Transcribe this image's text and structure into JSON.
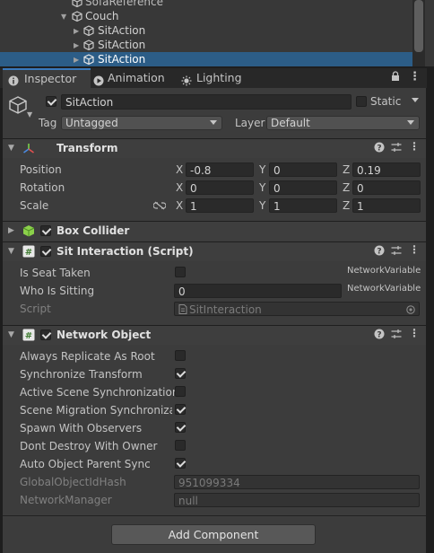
{
  "hierarchy": {
    "rows": [
      {
        "label": "SofaReference",
        "y": -6,
        "indent": 80,
        "arrow": false
      },
      {
        "label": "Couch",
        "y": 10,
        "indent": 66,
        "arrow": true
      },
      {
        "label": "SitAction",
        "y": 26,
        "indent": 80,
        "arrow": true
      },
      {
        "label": "SitAction",
        "y": 42,
        "indent": 80,
        "arrow": true
      },
      {
        "label": "SitAction",
        "y": 58,
        "indent": 80,
        "arrow": true,
        "selected": true
      }
    ]
  },
  "tabs": {
    "inspector": "Inspector",
    "animation": "Animation",
    "lighting": "Lighting"
  },
  "object": {
    "name": "SitAction",
    "static_label": "Static",
    "tag_label": "Tag",
    "tag_value": "Untagged",
    "layer_label": "Layer",
    "layer_value": "Default"
  },
  "transform": {
    "title": "Transform",
    "position_label": "Position",
    "rotation_label": "Rotation",
    "scale_label": "Scale",
    "position": {
      "x": "-0.8",
      "y": "0",
      "z": "0.19"
    },
    "rotation": {
      "x": "0",
      "y": "0",
      "z": "0"
    },
    "scale": {
      "x": "1",
      "y": "1",
      "z": "1"
    },
    "axis_x": "X",
    "axis_y": "Y",
    "axis_z": "Z"
  },
  "box_collider": {
    "title": "Box Collider"
  },
  "sit_interaction": {
    "title": "Sit Interaction (Script)",
    "is_seat_taken_label": "Is Seat Taken",
    "who_is_sitting_label": "Who Is Sitting",
    "who_is_sitting_value": "0",
    "network_variable_1": "NetworkVariable",
    "network_variable_2": "NetworkVariable",
    "script_label": "Script",
    "script_value": "SitInteraction"
  },
  "network_object": {
    "title": "Network Object",
    "always_replicate_label": "Always Replicate As Root",
    "sync_transform_label": "Synchronize Transform",
    "active_scene_label": "Active Scene Synchronization",
    "scene_migration_label": "Scene Migration Synchronizat",
    "spawn_observers_label": "Spawn With Observers",
    "dont_destroy_label": "Dont Destroy With Owner",
    "auto_parent_label": "Auto Object Parent Sync",
    "hash_label": "GlobalObjectIdHash",
    "hash_value": "951099334",
    "network_manager_label": "NetworkManager",
    "network_manager_value": "null"
  },
  "add_component": "Add Component",
  "colors": {
    "selection": "#2c5d87",
    "tab_accent": "#3a79bb",
    "script_icon_bg": "#4b8d3f",
    "box_collider_icon": "#8bd14a"
  }
}
